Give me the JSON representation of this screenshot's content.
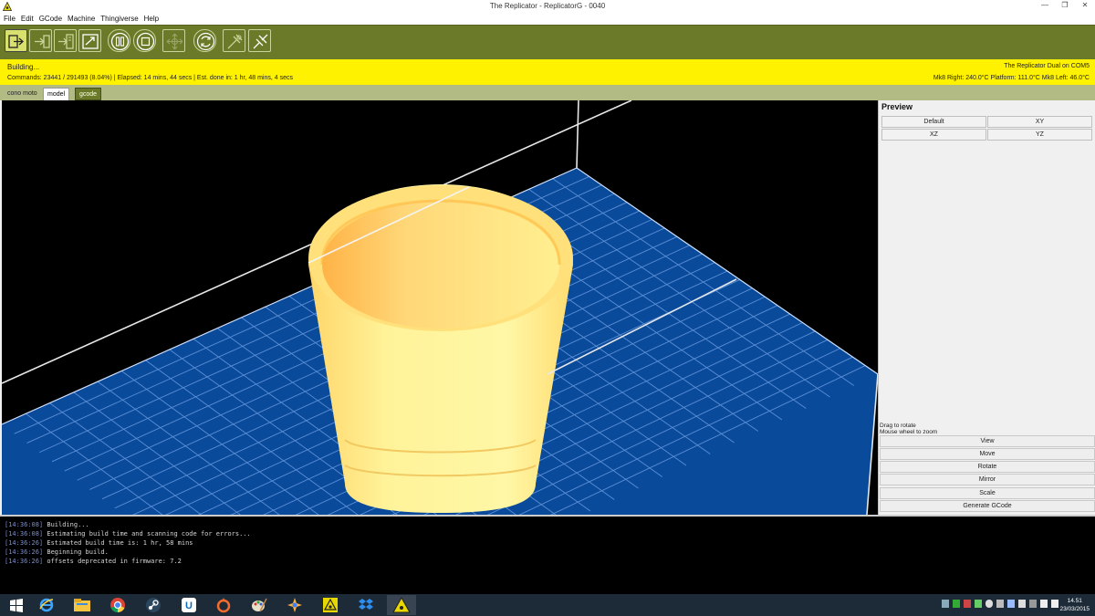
{
  "window": {
    "title": "The Replicator - ReplicatorG - 0040",
    "controls": [
      "minimize-icon",
      "restore-icon",
      "close-icon"
    ]
  },
  "menu": [
    "File",
    "Edit",
    "GCode",
    "Machine",
    "Thingiverse",
    "Help"
  ],
  "toolbar": {
    "buttons": [
      "build-icon",
      "build-to-file-icon",
      "upload-icon",
      "build-to-sd-icon",
      "pause-icon",
      "stop-icon",
      "control-panel-icon",
      "reset-icon",
      "connect-icon",
      "disconnect-icon"
    ]
  },
  "status": {
    "state": "Building...",
    "progress_line": "Commands:  23441  /  291493  (8.04%) | Elapsed: 14 mins, 44 secs  |  Est. done in:  1 hr, 48 mins, 4 secs",
    "progress_fraction": 0.0804,
    "machine": "The Replicator Dual on COM5",
    "temps": "Mk8 Right: 240.0°C  Platform: 111.0°C Mk8 Left: 46.0°C"
  },
  "tabs": [
    {
      "label": "cono moto"
    },
    {
      "label": "model"
    },
    {
      "label": "gcode"
    }
  ],
  "panel": {
    "title": "Preview",
    "view_buttons": [
      "Default",
      "XY",
      "XZ",
      "YZ"
    ],
    "hint1": "Drag to rotate",
    "hint2": "Mouse wheel to zoom",
    "actions": [
      "View",
      "Move",
      "Rotate",
      "Mirror",
      "Scale",
      "Generate GCode"
    ]
  },
  "console": [
    {
      "ts": "[14:36:08]",
      "msg": "Building..."
    },
    {
      "ts": "[14:36:08]",
      "msg": "Estimating build time and scanning code for errors..."
    },
    {
      "ts": "[14:36:26]",
      "msg": "Estimated build time is: 1 hr, 58 mins"
    },
    {
      "ts": "[14:36:26]",
      "msg": "Beginning build."
    },
    {
      "ts": "[14:36:26]",
      "msg": "offsets deprecated in firmware: 7.2"
    }
  ],
  "taskbar": {
    "apps": [
      "windows-start-icon",
      "internet-explorer-icon",
      "file-explorer-icon",
      "chrome-icon",
      "steam-icon",
      "uplay-icon",
      "origin-icon",
      "paint-icon",
      "game-icon",
      "replicatorg-icon",
      "dropbox-icon",
      "replicatorg-running-icon"
    ],
    "time": "14.51",
    "date": "23/03/2015"
  },
  "colors": {
    "toolbar": "#6b7a28",
    "status": "#fff200",
    "platform": "#0a4a9a",
    "model": "#ffee80"
  }
}
